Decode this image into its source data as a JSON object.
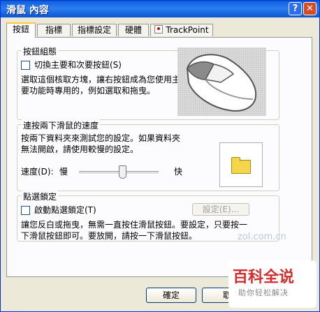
{
  "window": {
    "title": "滑鼠 內容",
    "help_label": "?",
    "close_label": "✕"
  },
  "tabs": [
    {
      "label": "按鈕",
      "active": true
    },
    {
      "label": "指標"
    },
    {
      "label": "指標設定"
    },
    {
      "label": "硬體"
    },
    {
      "label": "TrackPoint",
      "icon": "trackpoint-icon"
    }
  ],
  "buttons_group": {
    "title": "按鈕組態",
    "switch_checkbox_label": "切換主要和次要按鈕(S)",
    "description_line1": "選取這個核取方塊，讓右按鈕成為您使用主",
    "description_line2": "要功能時專用的，例如選取和拖曳。"
  },
  "double_click_group": {
    "title": "連按兩下滑鼠的速度",
    "description_line1": "按兩下資料夾來測試您的設定。如果資料夾",
    "description_line2": "無法開啟，請使用較慢的設定。",
    "speed_label": "速度(D):",
    "slow_label": "慢",
    "fast_label": "快",
    "speed_value": 0.55,
    "folder_icon": "folder-icon"
  },
  "click_lock_group": {
    "title": "點選鎖定",
    "checkbox_label": "啟動點選鎖定(T)",
    "settings_button": "設定(E)...",
    "description_line1": "讓您反白或拖曳，無需一直按住滑鼠按鈕。要設定，只要按一",
    "description_line2": "下滑鼠按鈕即可。要放開，請按一下滑鼠按鈕。"
  },
  "footer": {
    "ok_label": "確定",
    "cancel_label": "取"
  },
  "watermarks": {
    "zol": "zol.com.cn",
    "brand": "百科全说",
    "brand_sub": "助你轻松解决"
  }
}
